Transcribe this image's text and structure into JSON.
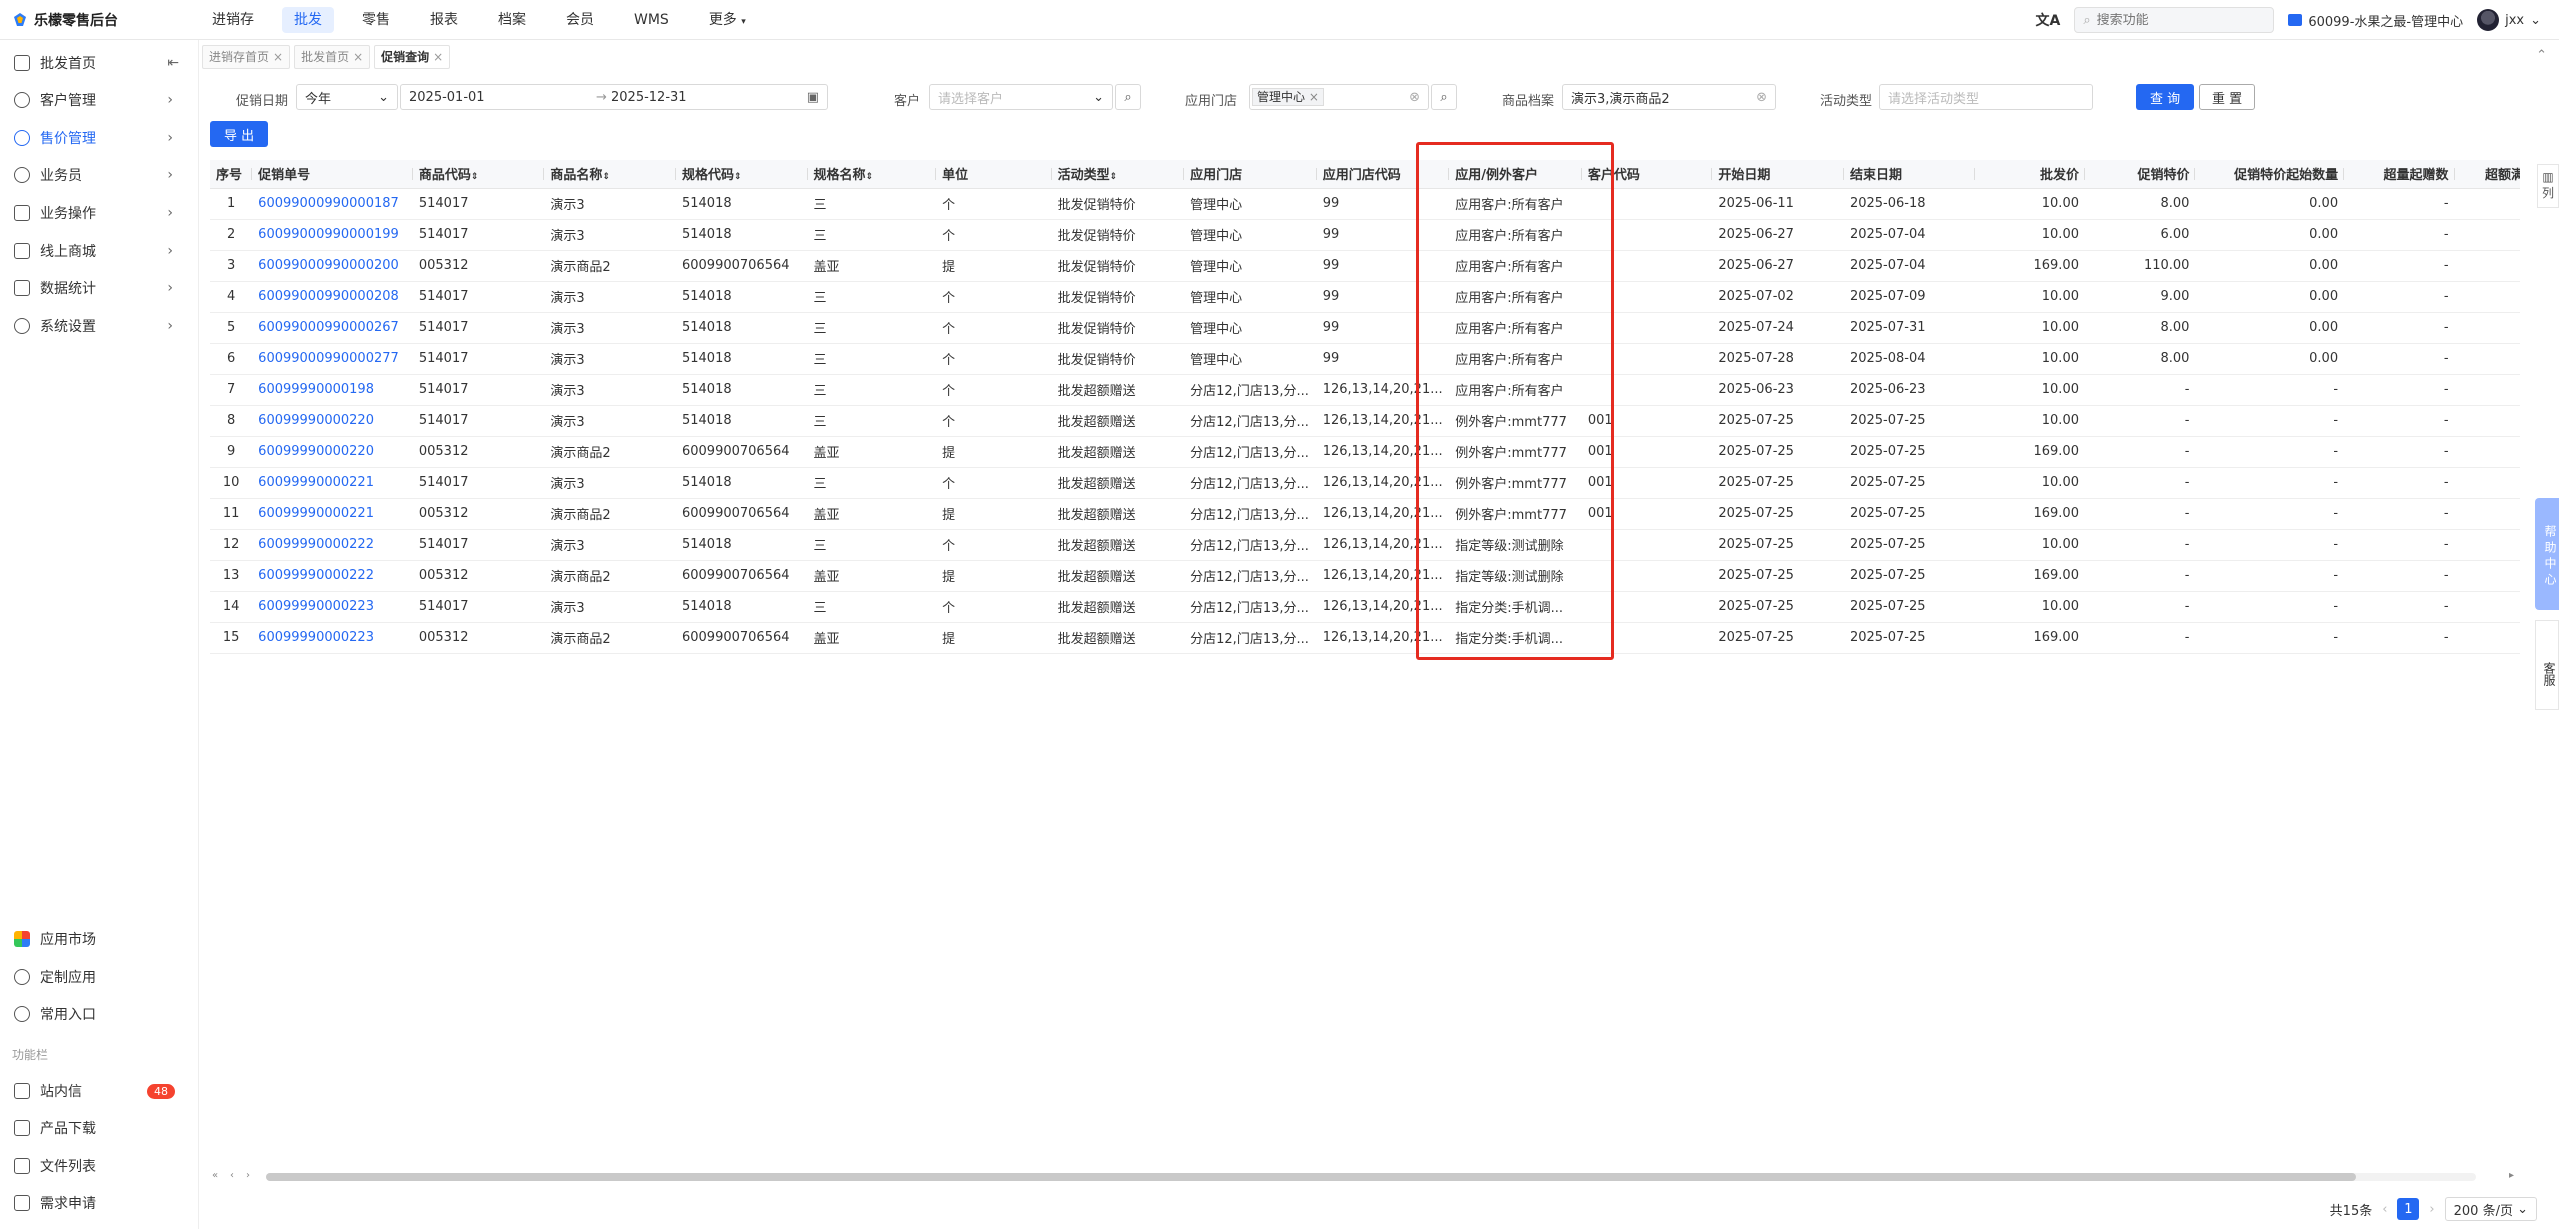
{
  "app": {
    "title": "乐檬零售后台"
  },
  "topnav": [
    "进销存",
    "批发",
    "零售",
    "报表",
    "档案",
    "会员",
    "WMS",
    "更多"
  ],
  "topright": {
    "search_placeholder": "搜索功能",
    "org": "60099-水果之最-管理中心",
    "user": "jxx"
  },
  "sidebar": {
    "items": [
      "批发首页",
      "客户管理",
      "售价管理",
      "业务员",
      "业务操作",
      "线上商城",
      "数据统计",
      "系统设置"
    ],
    "bottom_items": [
      "应用市场",
      "定制应用",
      "常用入口"
    ],
    "section_label": "功能栏",
    "func_items": [
      "站内信",
      "产品下载",
      "文件列表",
      "需求申请"
    ],
    "badge": "48"
  },
  "tabs": [
    "进销存首页",
    "批发首页",
    "促销查询"
  ],
  "filters": {
    "date_label": "促销日期",
    "date_mode": "今年",
    "date_start": "2025-01-01",
    "date_end": "2025-12-31",
    "date_sep": "→",
    "customer_label": "客户",
    "customer_placeholder": "请选择客户",
    "store_label": "应用门店",
    "store_tag": "管理中心",
    "goods_label": "商品档案",
    "goods_value": "演示3,演示商品2",
    "activity_label": "活动类型",
    "activity_placeholder": "请选择活动类型",
    "query_btn": "查 询",
    "reset_btn": "重 置",
    "export_btn": "导 出"
  },
  "table": {
    "columns": [
      "序号",
      "促销单号",
      "商品代码",
      "商品名称",
      "规格代码",
      "规格名称",
      "单位",
      "活动类型",
      "应用门店",
      "应用门店代码",
      "应用/例外客户",
      "客户代码",
      "开始日期",
      "结束日期",
      "批发价",
      "促销特价",
      "促销特价起始数量",
      "超量起赠数",
      "超额满"
    ],
    "rows": [
      [
        "1",
        "60099000990000187",
        "514017",
        "演示3",
        "514018",
        "三",
        "个",
        "批发促销特价",
        "管理中心",
        "99",
        "应用客户:所有客户",
        "",
        "2025-06-11",
        "2025-06-18",
        "10.00",
        "8.00",
        "0.00",
        "-",
        ""
      ],
      [
        "2",
        "60099000990000199",
        "514017",
        "演示3",
        "514018",
        "三",
        "个",
        "批发促销特价",
        "管理中心",
        "99",
        "应用客户:所有客户",
        "",
        "2025-06-27",
        "2025-07-04",
        "10.00",
        "6.00",
        "0.00",
        "-",
        ""
      ],
      [
        "3",
        "60099000990000200",
        "005312",
        "演示商品2",
        "6009900706564",
        "盖亚",
        "提",
        "批发促销特价",
        "管理中心",
        "99",
        "应用客户:所有客户",
        "",
        "2025-06-27",
        "2025-07-04",
        "169.00",
        "110.00",
        "0.00",
        "-",
        ""
      ],
      [
        "4",
        "60099000990000208",
        "514017",
        "演示3",
        "514018",
        "三",
        "个",
        "批发促销特价",
        "管理中心",
        "99",
        "应用客户:所有客户",
        "",
        "2025-07-02",
        "2025-07-09",
        "10.00",
        "9.00",
        "0.00",
        "-",
        ""
      ],
      [
        "5",
        "60099000990000267",
        "514017",
        "演示3",
        "514018",
        "三",
        "个",
        "批发促销特价",
        "管理中心",
        "99",
        "应用客户:所有客户",
        "",
        "2025-07-24",
        "2025-07-31",
        "10.00",
        "8.00",
        "0.00",
        "-",
        ""
      ],
      [
        "6",
        "60099000990000277",
        "514017",
        "演示3",
        "514018",
        "三",
        "个",
        "批发促销特价",
        "管理中心",
        "99",
        "应用客户:所有客户",
        "",
        "2025-07-28",
        "2025-08-04",
        "10.00",
        "8.00",
        "0.00",
        "-",
        ""
      ],
      [
        "7",
        "60099990000198",
        "514017",
        "演示3",
        "514018",
        "三",
        "个",
        "批发超额赠送",
        "分店12,门店13,分...",
        "126,13,14,20,21...",
        "应用客户:所有客户",
        "",
        "2025-06-23",
        "2025-06-23",
        "10.00",
        "-",
        "-",
        "-",
        ""
      ],
      [
        "8",
        "60099990000220",
        "514017",
        "演示3",
        "514018",
        "三",
        "个",
        "批发超额赠送",
        "分店12,门店13,分...",
        "126,13,14,20,21...",
        "例外客户:mmt777",
        "001",
        "2025-07-25",
        "2025-07-25",
        "10.00",
        "-",
        "-",
        "-",
        ""
      ],
      [
        "9",
        "60099990000220",
        "005312",
        "演示商品2",
        "6009900706564",
        "盖亚",
        "提",
        "批发超额赠送",
        "分店12,门店13,分...",
        "126,13,14,20,21...",
        "例外客户:mmt777",
        "001",
        "2025-07-25",
        "2025-07-25",
        "169.00",
        "-",
        "-",
        "-",
        ""
      ],
      [
        "10",
        "60099990000221",
        "514017",
        "演示3",
        "514018",
        "三",
        "个",
        "批发超额赠送",
        "分店12,门店13,分...",
        "126,13,14,20,21...",
        "例外客户:mmt777",
        "001",
        "2025-07-25",
        "2025-07-25",
        "10.00",
        "-",
        "-",
        "-",
        ""
      ],
      [
        "11",
        "60099990000221",
        "005312",
        "演示商品2",
        "6009900706564",
        "盖亚",
        "提",
        "批发超额赠送",
        "分店12,门店13,分...",
        "126,13,14,20,21...",
        "例外客户:mmt777",
        "001",
        "2025-07-25",
        "2025-07-25",
        "169.00",
        "-",
        "-",
        "-",
        ""
      ],
      [
        "12",
        "60099990000222",
        "514017",
        "演示3",
        "514018",
        "三",
        "个",
        "批发超额赠送",
        "分店12,门店13,分...",
        "126,13,14,20,21...",
        "指定等级:测试删除",
        "",
        "2025-07-25",
        "2025-07-25",
        "10.00",
        "-",
        "-",
        "-",
        ""
      ],
      [
        "13",
        "60099990000222",
        "005312",
        "演示商品2",
        "6009900706564",
        "盖亚",
        "提",
        "批发超额赠送",
        "分店12,门店13,分...",
        "126,13,14,20,21...",
        "指定等级:测试删除",
        "",
        "2025-07-25",
        "2025-07-25",
        "169.00",
        "-",
        "-",
        "-",
        ""
      ],
      [
        "14",
        "60099990000223",
        "514017",
        "演示3",
        "514018",
        "三",
        "个",
        "批发超额赠送",
        "分店12,门店13,分...",
        "126,13,14,20,21...",
        "指定分类:手机调...",
        "",
        "2025-07-25",
        "2025-07-25",
        "10.00",
        "-",
        "-",
        "-",
        ""
      ],
      [
        "15",
        "60099990000223",
        "005312",
        "演示商品2",
        "6009900706564",
        "盖亚",
        "提",
        "批发超额赠送",
        "分店12,门店13,分...",
        "126,13,14,20,21...",
        "指定分类:手机调...",
        "",
        "2025-07-25",
        "2025-07-25",
        "169.00",
        "-",
        "-",
        "-",
        ""
      ]
    ]
  },
  "right_float": {
    "col_toggle": "列",
    "help": "帮助中心",
    "service": "客服"
  },
  "pager": {
    "total": "共15条",
    "page": "1",
    "page_size": "200 条/页"
  }
}
